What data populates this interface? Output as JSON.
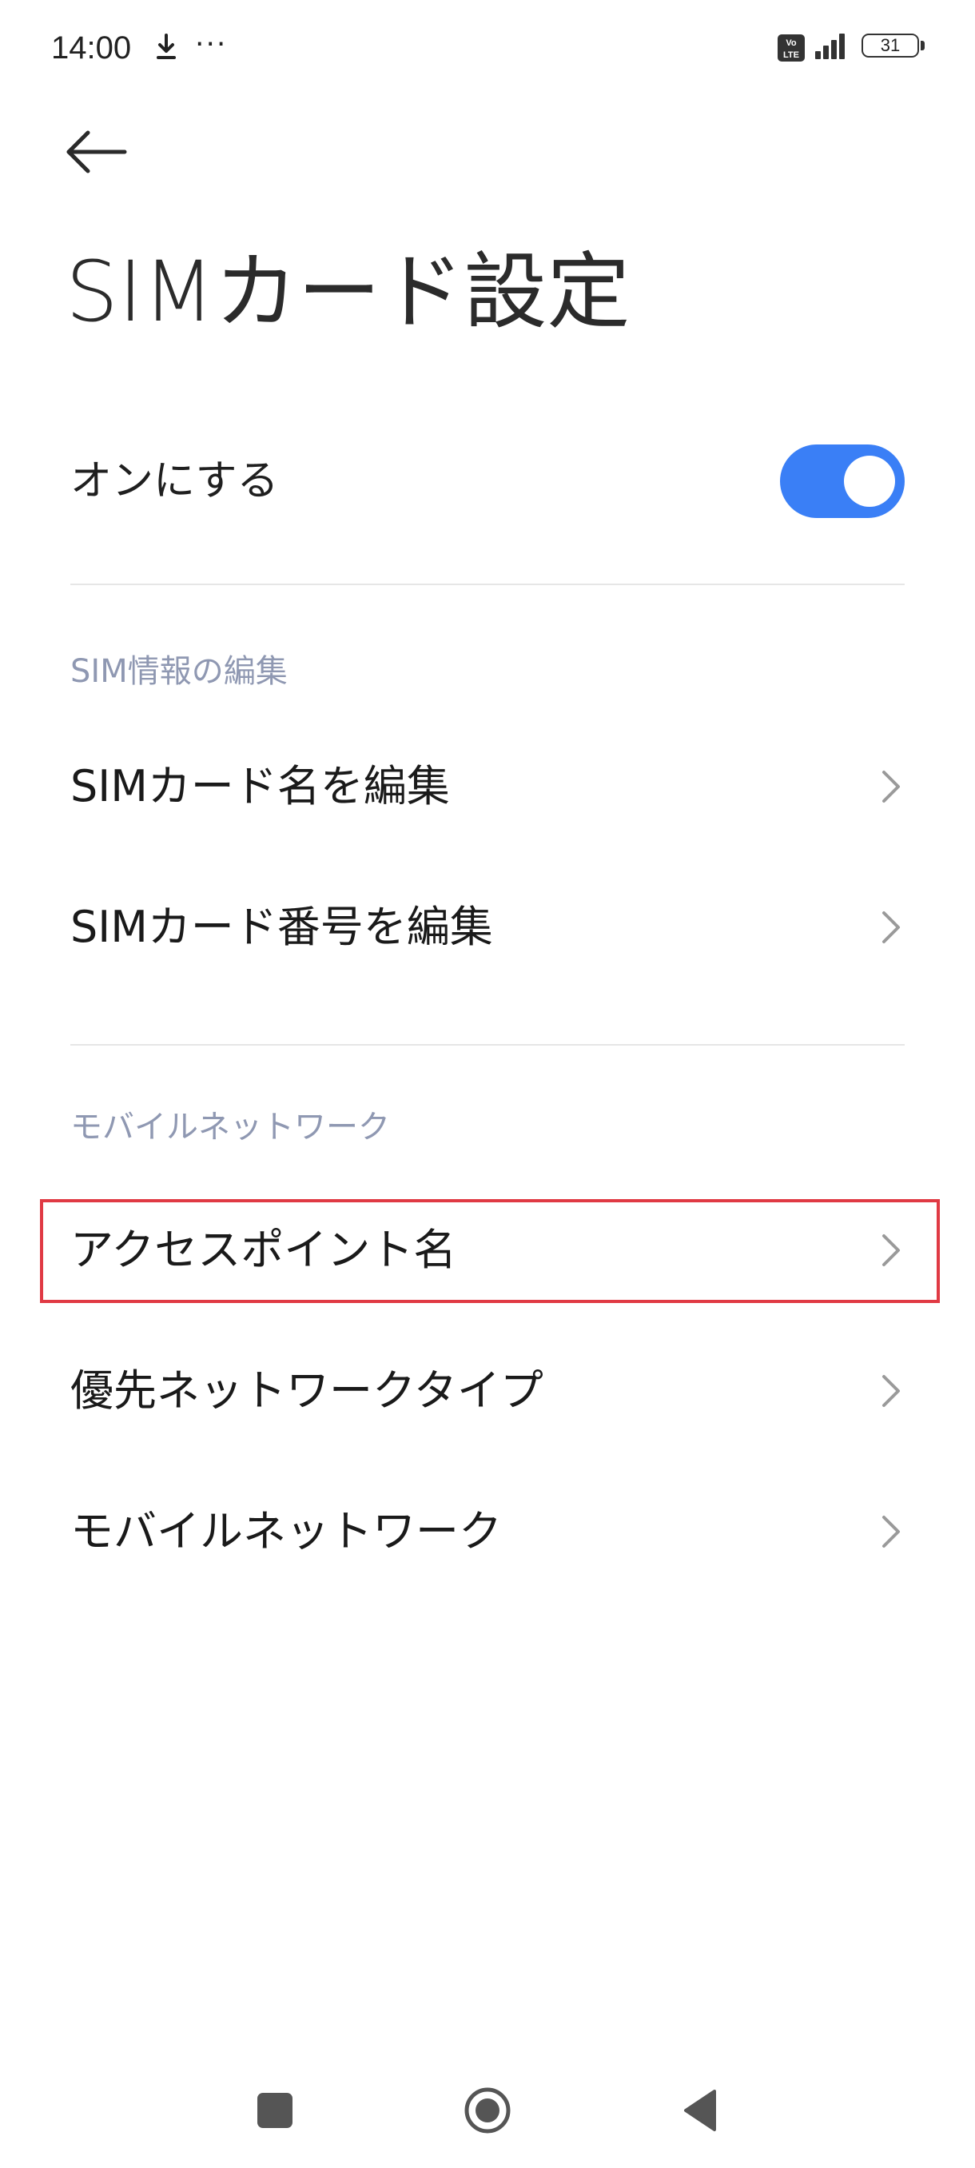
{
  "status_bar": {
    "time": "14:00",
    "more": "···",
    "battery": "31",
    "icons": [
      "download-icon",
      "volte-icon",
      "signal-icon",
      "battery-icon"
    ]
  },
  "header": {
    "back_icon": "arrow-left-icon",
    "title": "SIMカード設定"
  },
  "toggle": {
    "label": "オンにする",
    "state": true,
    "accent_color": "#3a7ff6"
  },
  "sections": {
    "sim_info": {
      "header": "SIM情報の編集",
      "items": [
        {
          "label": "SIMカード名を編集"
        },
        {
          "label": "SIMカード番号を編集"
        }
      ]
    },
    "mobile_network": {
      "header": "モバイルネットワーク",
      "items": [
        {
          "label": "アクセスポイント名",
          "highlighted": true
        },
        {
          "label": "優先ネットワークタイプ"
        },
        {
          "label": "モバイルネットワーク"
        }
      ]
    }
  },
  "colors": {
    "section_header": "#8f98b2",
    "highlight_border": "#e03a44",
    "divider": "#e6e6e6"
  },
  "nav_bar": {
    "icons": [
      "square-recents-icon",
      "circle-home-icon",
      "triangle-back-icon"
    ]
  }
}
